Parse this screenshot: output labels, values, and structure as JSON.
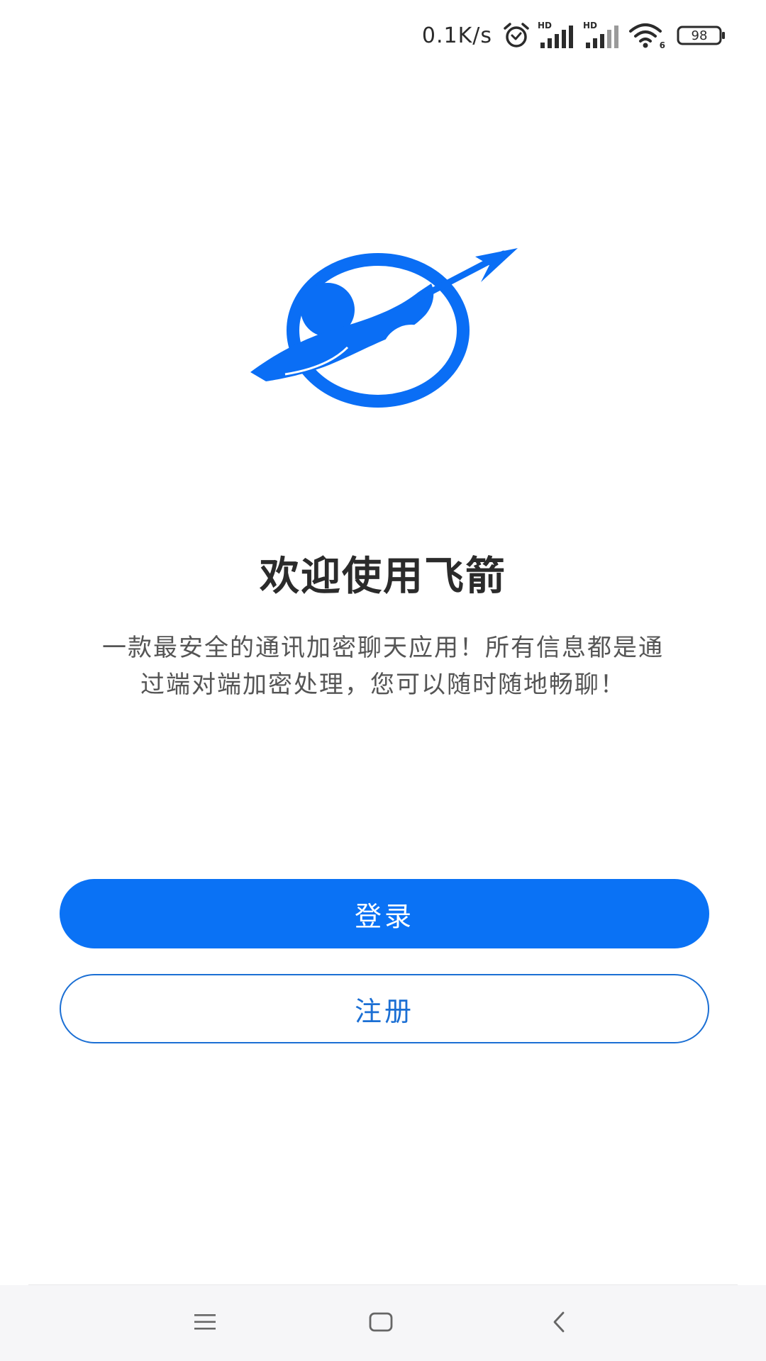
{
  "status_bar": {
    "net_speed": "0.1K/s",
    "signal_label_1": "HD",
    "signal_label_2": "HD",
    "wifi_sub": "6",
    "battery": "98",
    "icons": [
      "alarm-icon",
      "signal-icon",
      "signal-icon",
      "wifi-icon",
      "battery-icon"
    ]
  },
  "logo": {
    "icon": "flying-arrow-logo-icon",
    "color": "#0a6ef5"
  },
  "welcome": {
    "title": "欢迎使用飞箭",
    "description_line1": "一款最安全的通讯加密聊天应用！所有信息都是通",
    "description_line2": "过端对端加密处理，您可以随时随地畅聊！"
  },
  "buttons": {
    "login_label": "登录",
    "register_label": "注册",
    "primary_color": "#0a72f5",
    "outline_color": "#1b6fd4"
  },
  "nav_bar": {
    "icons": [
      "menu-icon",
      "home-icon",
      "back-icon"
    ]
  }
}
